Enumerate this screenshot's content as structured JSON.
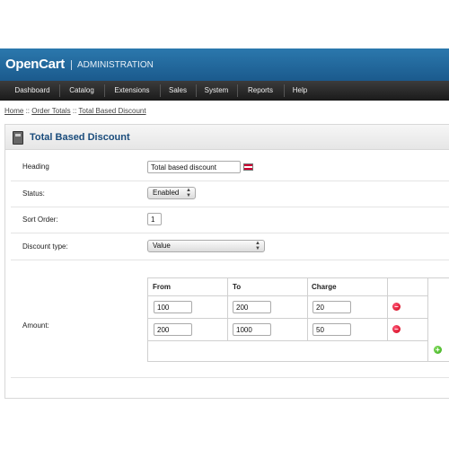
{
  "header": {
    "brand": "OpenCart",
    "subtitle": "ADMINISTRATION"
  },
  "menu": {
    "items": [
      "Dashboard",
      "Catalog",
      "Extensions",
      "Sales",
      "System",
      "Reports",
      "Help"
    ]
  },
  "breadcrumb": {
    "home": "Home",
    "sep1": " :: ",
    "order_totals": "Order Totals",
    "sep2": " :: ",
    "current": "Total Based Discount"
  },
  "panel": {
    "title": "Total Based Discount"
  },
  "form": {
    "heading_label": "Heading",
    "heading_value": "Total based discount",
    "status_label": "Status:",
    "status_value": "Enabled",
    "sort_order_label": "Sort Order:",
    "sort_order_value": "1",
    "discount_type_label": "Discount type:",
    "discount_type_value": "Value",
    "amount_label": "Amount:"
  },
  "amount_table": {
    "headers": [
      "From",
      "To",
      "Charge"
    ],
    "rows": [
      {
        "from": "100",
        "to": "200",
        "charge": "20"
      },
      {
        "from": "200",
        "to": "1000",
        "charge": "50"
      }
    ]
  },
  "icons": {
    "remove": "remove-icon",
    "add": "add-icon",
    "flag": "uk-flag-icon",
    "calculator": "calculator-icon"
  },
  "colors": {
    "header_blue": "#1b5a8d",
    "title_blue": "#1a4c7c",
    "menu_dark": "#1a1a1a",
    "remove_red": "#cc0011",
    "add_green": "#33aa11"
  }
}
